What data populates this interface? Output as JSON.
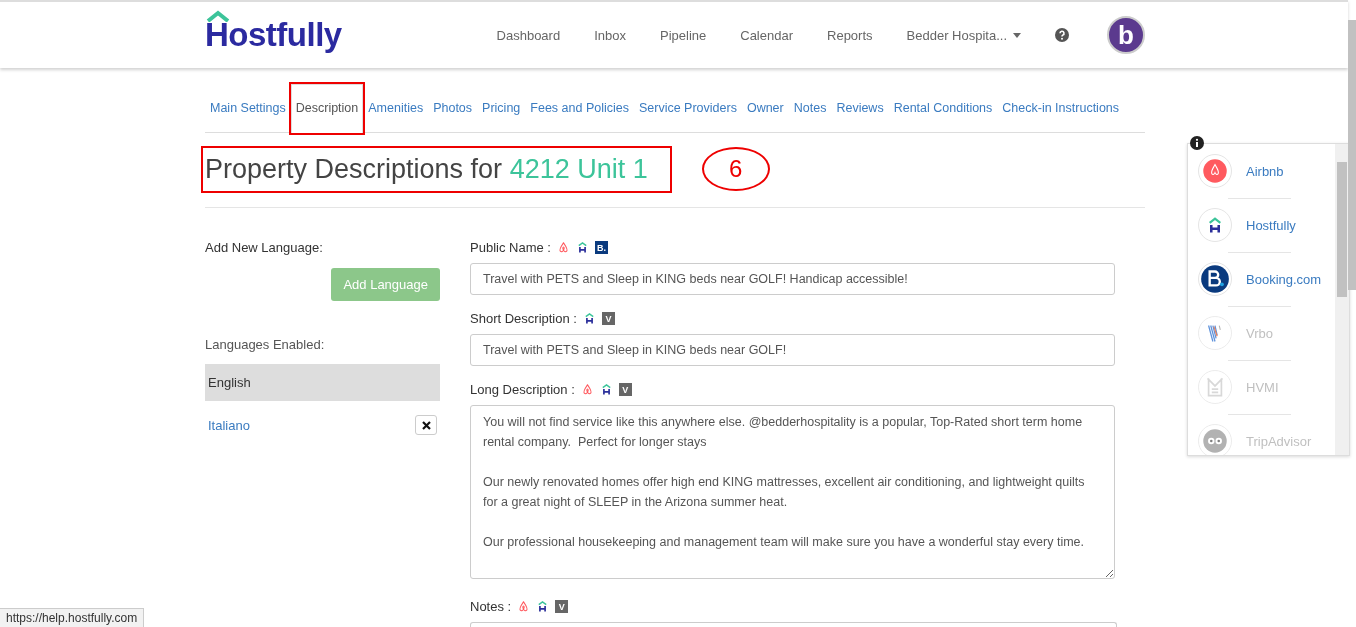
{
  "header": {
    "logo": "Hostfully",
    "nav": [
      {
        "label": "Dashboard",
        "kind": "link"
      },
      {
        "label": "Inbox",
        "kind": "link"
      },
      {
        "label": "Pipeline",
        "kind": "link"
      },
      {
        "label": "Calendar",
        "kind": "link"
      },
      {
        "label": "Reports",
        "kind": "link"
      },
      {
        "label": "Bedder Hospita...",
        "kind": "dropdown"
      }
    ],
    "avatar_letter": "b"
  },
  "tabs": [
    {
      "label": "Main Settings",
      "selected": false,
      "highlighted": false
    },
    {
      "label": "Description",
      "selected": true,
      "highlighted": true
    },
    {
      "label": "Amenities",
      "selected": false,
      "highlighted": false
    },
    {
      "label": "Photos",
      "selected": false,
      "highlighted": false
    },
    {
      "label": "Pricing",
      "selected": false,
      "highlighted": false
    },
    {
      "label": "Fees and Policies",
      "selected": false,
      "highlighted": false
    },
    {
      "label": "Service Providers",
      "selected": false,
      "highlighted": false
    },
    {
      "label": "Owner",
      "selected": false,
      "highlighted": false
    },
    {
      "label": "Notes",
      "selected": false,
      "highlighted": false
    },
    {
      "label": "Reviews",
      "selected": false,
      "highlighted": false
    },
    {
      "label": "Rental Conditions",
      "selected": false,
      "highlighted": false
    },
    {
      "label": "Check-in Instructions",
      "selected": false,
      "highlighted": false
    }
  ],
  "title": {
    "prefix": "Property Descriptions for",
    "property": "4212 Unit 1",
    "highlighted": true
  },
  "annotation_marker": "6",
  "languages": {
    "add_label": "Add New Language:",
    "add_button": "Add Language",
    "enabled_label": "Languages Enabled:",
    "items": [
      {
        "name": "English",
        "selected": true,
        "removable": false
      },
      {
        "name": "Italiano",
        "selected": false,
        "removable": true
      }
    ]
  },
  "fields": [
    {
      "label": "Public Name :",
      "channels": [
        {
          "kind": "airbnb"
        },
        {
          "kind": "hostfully"
        },
        {
          "kind": "booking",
          "letter": "B."
        }
      ],
      "kind": "input",
      "value": "Travel with PETS and Sleep in KING beds near GOLF! Handicap accessible!"
    },
    {
      "label": "Short Description :",
      "channels": [
        {
          "kind": "hostfully"
        },
        {
          "kind": "vrbo",
          "letter": "V"
        }
      ],
      "kind": "input",
      "value": "Travel with PETS and Sleep in KING beds near GOLF!"
    },
    {
      "label": "Long Description :",
      "channels": [
        {
          "kind": "airbnb"
        },
        {
          "kind": "hostfully"
        },
        {
          "kind": "vrbo",
          "letter": "V"
        }
      ],
      "kind": "textarea",
      "value": "You will not find service like this anywhere else. @bedderhospitality is a popular, Top-Rated short term home rental company.  Perfect for longer stays\n\nOur newly renovated homes offer high end KING mattresses, excellent air conditioning, and lightweight quilts for a great night of SLEEP in the Arizona summer heat.\n\nOur professional housekeeping and management team will make sure you have a wonderful stay every time."
    },
    {
      "label": "Notes :",
      "channels": [
        {
          "kind": "airbnb"
        },
        {
          "kind": "hostfully"
        },
        {
          "kind": "vrbo",
          "letter": "V"
        }
      ],
      "kind": "cut"
    }
  ],
  "channel_panel": [
    {
      "name": "Airbnb",
      "kind": "airbnb",
      "enabled": true
    },
    {
      "name": "Hostfully",
      "kind": "hostfully",
      "enabled": true
    },
    {
      "name": "Booking.com",
      "kind": "booking",
      "enabled": true
    },
    {
      "name": "Vrbo",
      "kind": "vrbo",
      "enabled": false
    },
    {
      "name": "HVMI",
      "kind": "hvmi",
      "enabled": false
    },
    {
      "name": "TripAdvisor",
      "kind": "tripadvisor",
      "enabled": false
    }
  ],
  "status_url": "https://help.hostfully.com"
}
